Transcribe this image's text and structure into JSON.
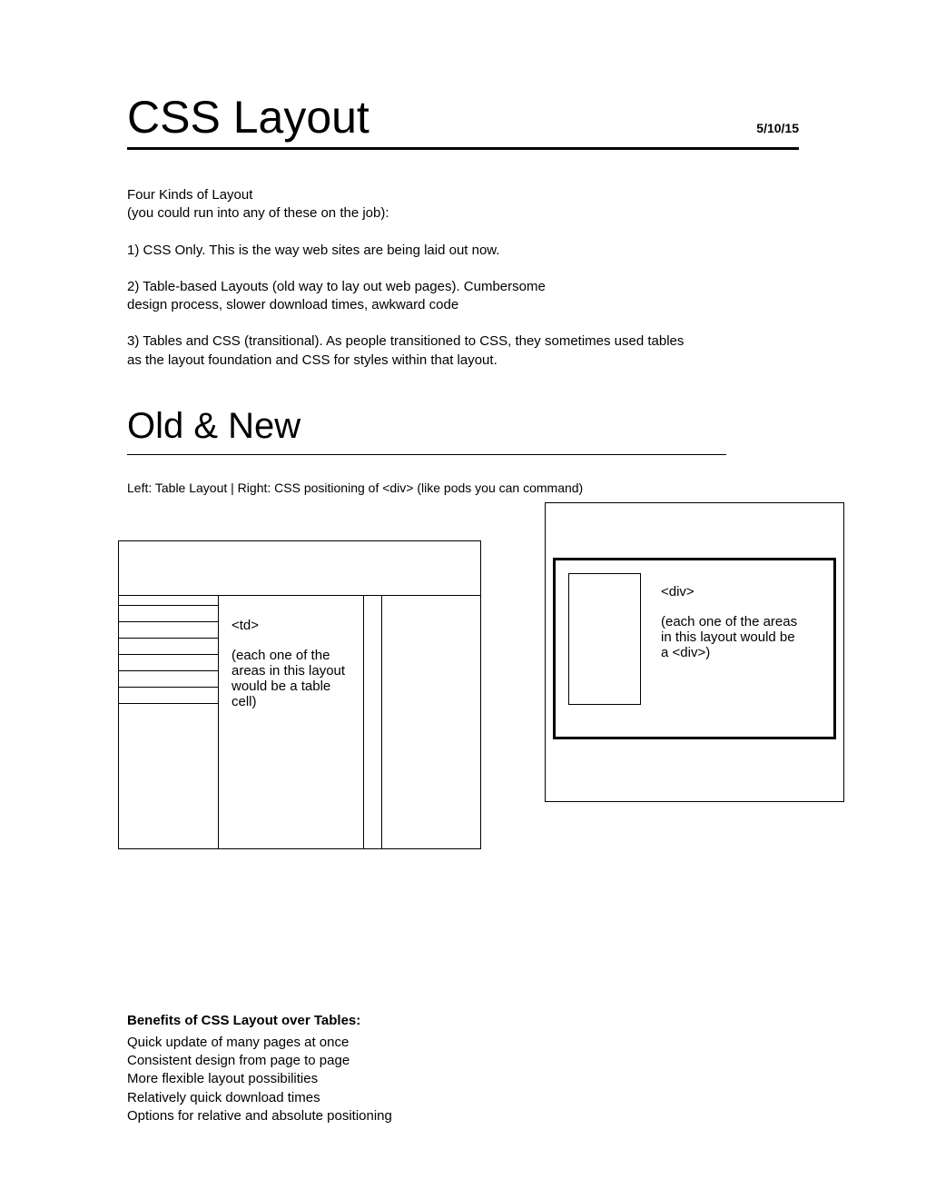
{
  "header": {
    "title": "CSS Layout",
    "date": "5/10/15"
  },
  "intro": {
    "p1": "Four Kinds of Layout\n(you could run into any of these on the job):",
    "p2": "1) CSS Only.  This is the way web sites are being laid out now.",
    "p3": "2) Table-based Layouts (old way to lay out web pages). Cumbersome design process, slower download times, awkward code",
    "p4": "3) Tables and CSS (transitional).  As people transitioned to CSS, they sometimes used tables as the layout foundation and CSS for styles within that layout."
  },
  "section2": {
    "title": "Old & New",
    "caption": "Left: Table Layout | Right: CSS positioning of <div> (like pods you can command)",
    "left_label_1": "<td>",
    "left_label_2": "(each one of the areas in this layout would be a table cell)",
    "right_label_1": "<div>",
    "right_label_2": "(each one of the areas in this layout would be a <div>)"
  },
  "benefits": {
    "heading": "Benefits of CSS Layout over Tables:",
    "items": [
      "Quick update of many pages at once",
      "Consistent design from page to page",
      "More flexible layout possibilities",
      "Relatively quick download times",
      "Options for relative and absolute positioning"
    ]
  }
}
